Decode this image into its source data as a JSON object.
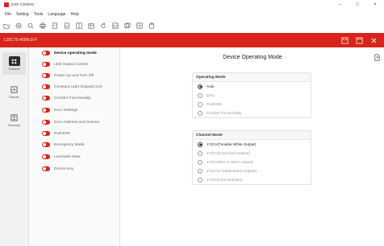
{
  "window": {
    "title": "KGP CONFIG",
    "controls": [
      "–",
      "□",
      "×"
    ]
  },
  "menu": [
    "File",
    "Setting",
    "Tools",
    "Language",
    "Help"
  ],
  "toolbar": {
    "icons": [
      "folder-icon",
      "plus-icon",
      "search-icon",
      "print-icon",
      "document-icon",
      "document-copy-icon",
      "columns-icon",
      "calendar-icon",
      "refresh-icon",
      "database-icon",
      "layers-icon",
      "grid-icon",
      "clipboard-icon"
    ]
  },
  "header": {
    "device": "L35C75-400N-D-F"
  },
  "rail": [
    {
      "label": "Features",
      "icon": "features-icon",
      "active": true
    },
    {
      "label": "Reports",
      "icon": "reports-icon",
      "active": false
    },
    {
      "label": "Summary",
      "icon": "summary-icon",
      "active": false
    }
  ],
  "features": [
    {
      "label": "Device operating mode",
      "active": true
    },
    {
      "label": "LED Output Current",
      "active": false
    },
    {
      "label": "Power Up and Turn Off",
      "active": false
    },
    {
      "label": "Constant Light Output(CLO)",
      "active": false
    },
    {
      "label": "Corridor Functionality",
      "active": false
    },
    {
      "label": "DALI Settings",
      "active": false
    },
    {
      "label": "DALI Address and Scenes",
      "active": false
    },
    {
      "label": "PushDIM",
      "active": false
    },
    {
      "label": "Emergency Mode",
      "active": false
    },
    {
      "label": "Luminaire Data",
      "active": false
    },
    {
      "label": "Device Key",
      "active": false
    }
  ],
  "main": {
    "title": "Device Operating Mode",
    "operating_mode": {
      "heading": "Operating Mode",
      "options": [
        {
          "label": "Auto",
          "checked": true
        },
        {
          "label": "DALI",
          "checked": false
        },
        {
          "label": "PushDIM",
          "checked": false
        },
        {
          "label": "Corridor Functionality",
          "checked": false
        }
      ]
    },
    "channel_mode": {
      "heading": "Channel Mode",
      "options": [
        {
          "label": "1*2CH(Tunable White Output)",
          "checked": true
        },
        {
          "label": "1*2CH(2 synched outputs)",
          "checked": false
        },
        {
          "label": "1*2CH(Dim to Warm output)",
          "checked": false
        },
        {
          "label": "2*1CH(2 independent outputs)",
          "checked": false
        },
        {
          "label": "1*1CH(LED Modules)",
          "checked": false
        }
      ]
    }
  }
}
